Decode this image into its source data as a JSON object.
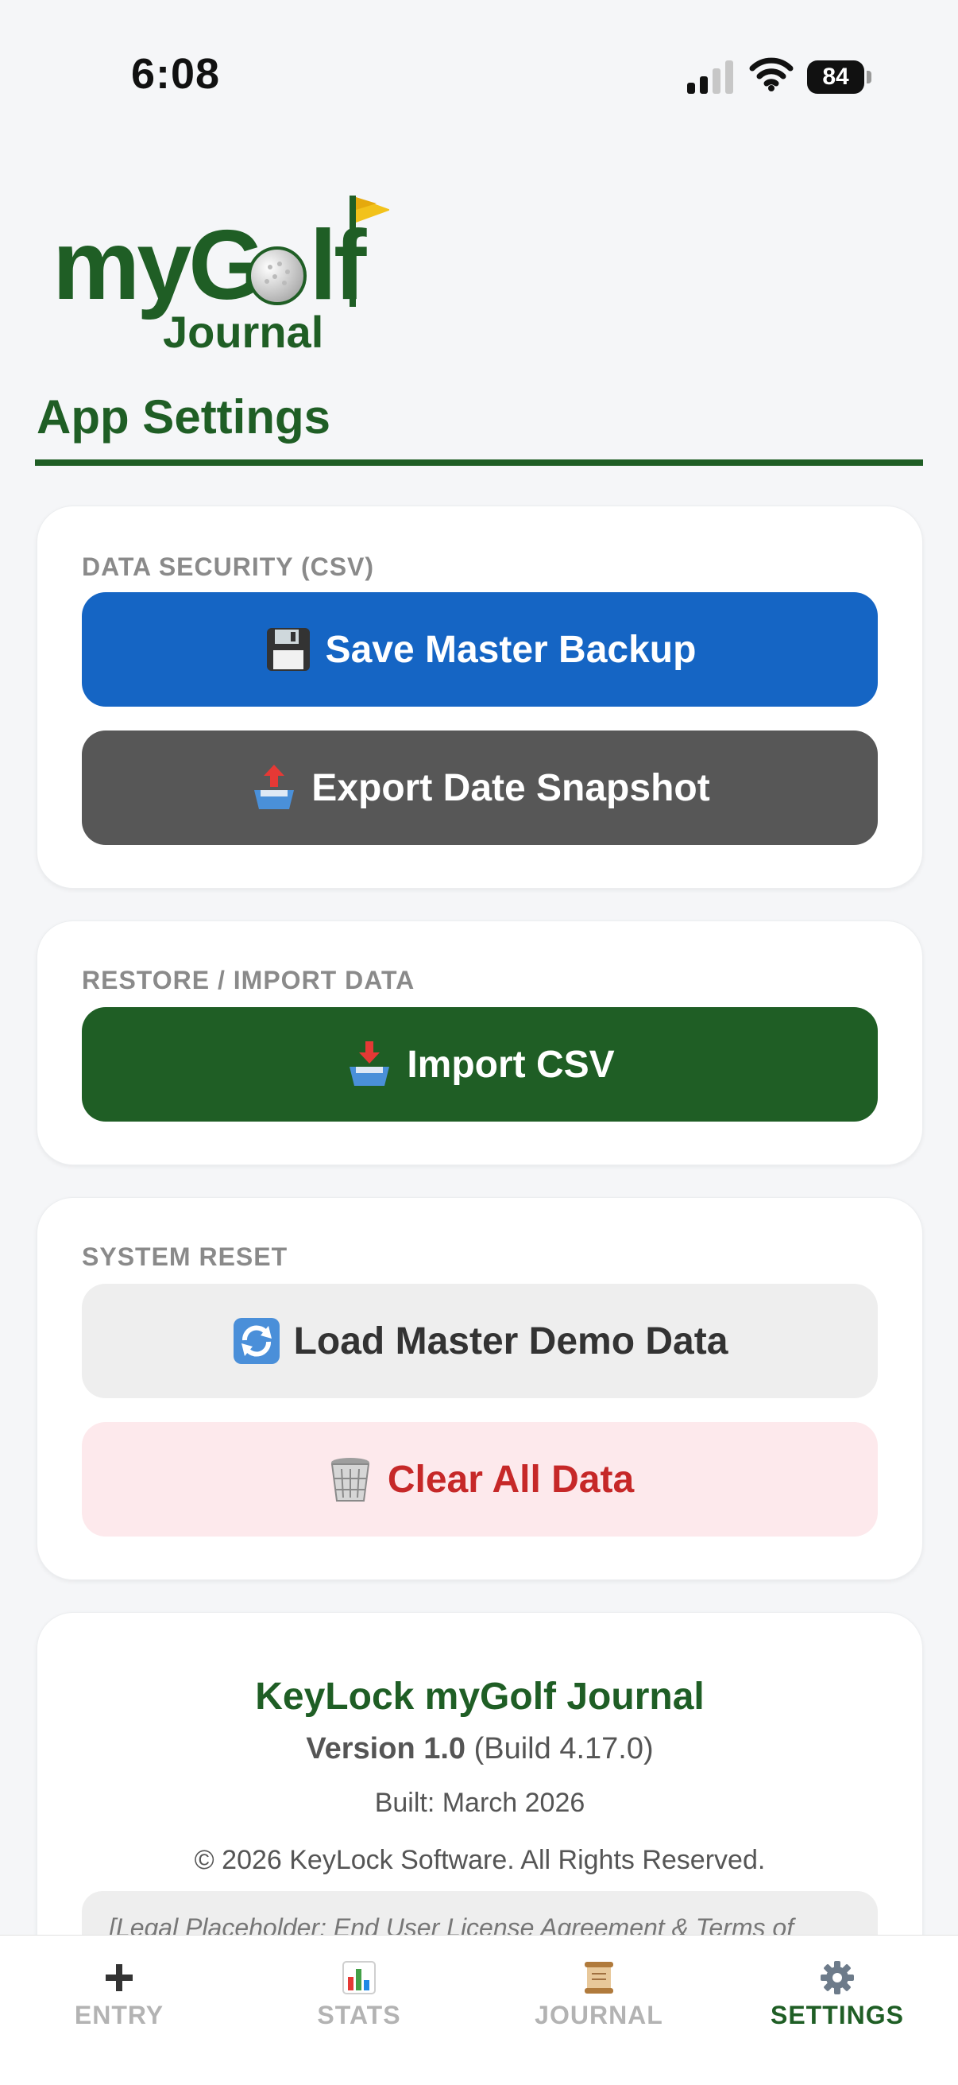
{
  "status_bar": {
    "time": "6:08",
    "battery": "84"
  },
  "logo": {
    "main_text_1": "myG",
    "main_text_2": "lf",
    "sub_text": "Journal"
  },
  "page": {
    "title": "App Settings"
  },
  "sections": {
    "data_security": {
      "label": "DATA SECURITY (CSV)",
      "save_backup": {
        "icon": "floppy-disk-icon",
        "label": "Save Master Backup"
      },
      "export_snapshot": {
        "icon": "outbox-tray-icon",
        "label": "Export Date Snapshot"
      }
    },
    "restore": {
      "label": "RESTORE / IMPORT DATA",
      "import_csv": {
        "icon": "inbox-tray-icon",
        "label": "Import CSV"
      }
    },
    "system_reset": {
      "label": "SYSTEM RESET",
      "load_demo": {
        "icon": "refresh-arrows-icon",
        "label": "Load Master Demo Data"
      },
      "clear_all": {
        "icon": "wastebasket-icon",
        "label": "Clear All Data"
      }
    }
  },
  "about": {
    "app_name": "KeyLock myGolf Journal",
    "version_label": "Version 1.0",
    "build": "(Build 4.17.0)",
    "built": "Built: March 2026",
    "copyright": "© 2026 KeyLock Software. All Rights Reserved.",
    "legal_text": "[Legal Placeholder: End User License Agreement & Terms of"
  },
  "tabs": [
    {
      "label": "ENTRY",
      "icon": "plus-icon"
    },
    {
      "label": "STATS",
      "icon": "bar-chart-icon"
    },
    {
      "label": "JOURNAL",
      "icon": "scroll-icon"
    },
    {
      "label": "SETTINGS",
      "icon": "gear-icon",
      "active": true
    }
  ],
  "colors": {
    "brand_green": "#1f5e25",
    "primary_blue": "#1565c4",
    "dark_gray": "#575757",
    "danger_red": "#c62828",
    "danger_bg": "#fde9ec"
  }
}
